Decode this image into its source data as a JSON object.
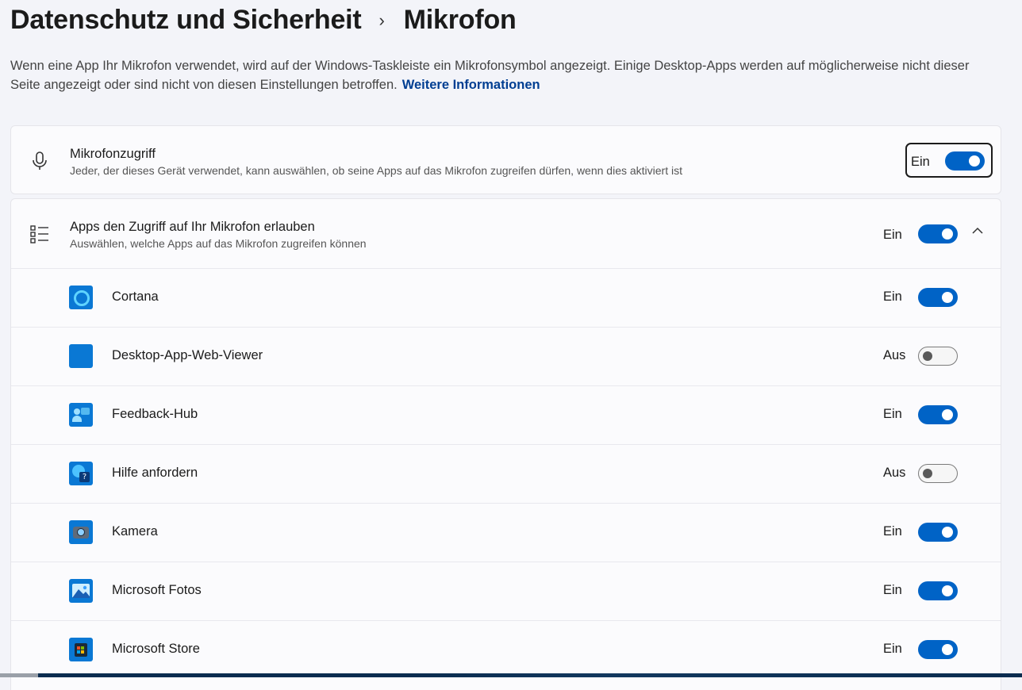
{
  "breadcrumb": {
    "parent": "Datenschutz und Sicherheit",
    "separator": "›",
    "current": "Mikrofon"
  },
  "description": {
    "text": "Wenn eine App Ihr Mikrofon verwendet, wird auf der Windows-Taskleiste ein Mikrofonsymbol angezeigt. Einige Desktop-Apps werden auf möglicherweise nicht dieser Seite angezeigt oder sind nicht von diesen Einstellungen betroffen.",
    "link": "Weitere Informationen"
  },
  "mic_access": {
    "title": "Mikrofonzugriff",
    "subtitle": "Jeder, der dieses Gerät verwendet, kann auswählen, ob seine Apps auf das Mikrofon zugreifen dürfen, wenn dies aktiviert ist",
    "state": "Ein",
    "on": true,
    "icon": "microphone-icon"
  },
  "apps_access": {
    "title": "Apps den Zugriff auf Ihr Mikrofon erlauben",
    "subtitle": "Auswählen, welche Apps auf das Mikrofon zugreifen können",
    "state": "Ein",
    "on": true,
    "icon": "list-icon",
    "expanded_icon": "chevron-up-icon"
  },
  "apps": [
    {
      "name": "Cortana",
      "state": "Ein",
      "on": true,
      "icon": "cortana-icon"
    },
    {
      "name": "Desktop-App-Web-Viewer",
      "state": "Aus",
      "on": false,
      "icon": "web-viewer-icon"
    },
    {
      "name": "Feedback-Hub",
      "state": "Ein",
      "on": true,
      "icon": "feedback-hub-icon"
    },
    {
      "name": "Hilfe anfordern",
      "state": "Aus",
      "on": false,
      "icon": "get-help-icon"
    },
    {
      "name": "Kamera",
      "state": "Ein",
      "on": true,
      "icon": "camera-icon"
    },
    {
      "name": "Microsoft Fotos",
      "state": "Ein",
      "on": true,
      "icon": "photos-icon"
    },
    {
      "name": "Microsoft Store",
      "state": "Ein",
      "on": true,
      "icon": "store-icon"
    }
  ],
  "colors": {
    "accent": "#0063c6",
    "link": "#003e92",
    "background": "#f3f4f9",
    "card": "#fbfbfd"
  }
}
